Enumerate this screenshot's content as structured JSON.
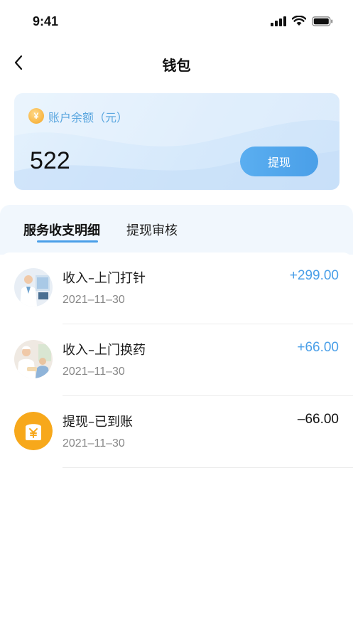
{
  "status_bar": {
    "time": "9:41",
    "icons": [
      "signal-icon",
      "wifi-icon",
      "battery-icon"
    ]
  },
  "nav": {
    "title": "钱包",
    "back_icon": "chevron-left-icon"
  },
  "wallet": {
    "balance_label": "账户余额（元）",
    "balance": "522",
    "withdraw_label": "提现",
    "coin_symbol": "¥"
  },
  "tabs": [
    {
      "label": "服务收支明细",
      "active": true
    },
    {
      "label": "提现审核",
      "active": false
    }
  ],
  "transactions": [
    {
      "title": "收入–上门打针",
      "date": "2021–11–30",
      "amount": "+299.00",
      "amount_color": "#4a9fe8",
      "avatar": "doctor-photo"
    },
    {
      "title": "收入–上门换药",
      "date": "2021–11–30",
      "amount": "+66.00",
      "amount_color": "#4a9fe8",
      "avatar": "nurse-photo"
    },
    {
      "title": "提现–已到账",
      "date": "2021–11–30",
      "amount": "–66.00",
      "amount_color": "#111111",
      "avatar": "withdraw-icon"
    }
  ],
  "colors": {
    "accent": "#4a9fe8",
    "coin": "#f5a623",
    "withdraw_icon_bg": "#f7a81b"
  }
}
